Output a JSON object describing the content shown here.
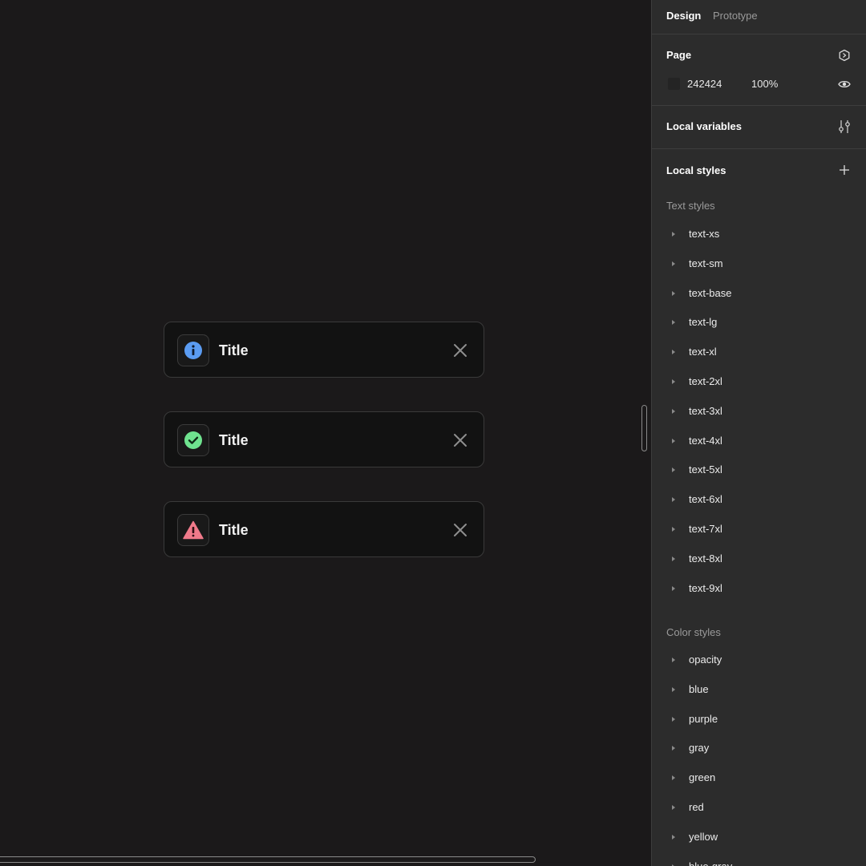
{
  "canvas": {
    "toasts": [
      {
        "title": "Title",
        "icon": "info-icon",
        "icon_color": "#5b9cf2"
      },
      {
        "title": "Title",
        "icon": "check-circle-icon",
        "icon_color": "#6fe38f"
      },
      {
        "title": "Title",
        "icon": "warning-icon",
        "icon_color": "#f07a8a"
      }
    ]
  },
  "panel": {
    "tabs": {
      "design": "Design",
      "prototype": "Prototype"
    },
    "page": {
      "title": "Page",
      "color_hex": "242424",
      "opacity": "100%",
      "swatch_color": "#242424"
    },
    "local_variables": {
      "title": "Local variables"
    },
    "local_styles": {
      "title": "Local styles",
      "text_styles": {
        "title": "Text styles",
        "items": [
          "text-xs",
          "text-sm",
          "text-base",
          "text-lg",
          "text-xl",
          "text-2xl",
          "text-3xl",
          "text-4xl",
          "text-5xl",
          "text-6xl",
          "text-7xl",
          "text-8xl",
          "text-9xl"
        ]
      },
      "color_styles": {
        "title": "Color styles",
        "items": [
          "opacity",
          "blue",
          "purple",
          "gray",
          "green",
          "red",
          "yellow",
          "blue-gray"
        ]
      }
    }
  }
}
